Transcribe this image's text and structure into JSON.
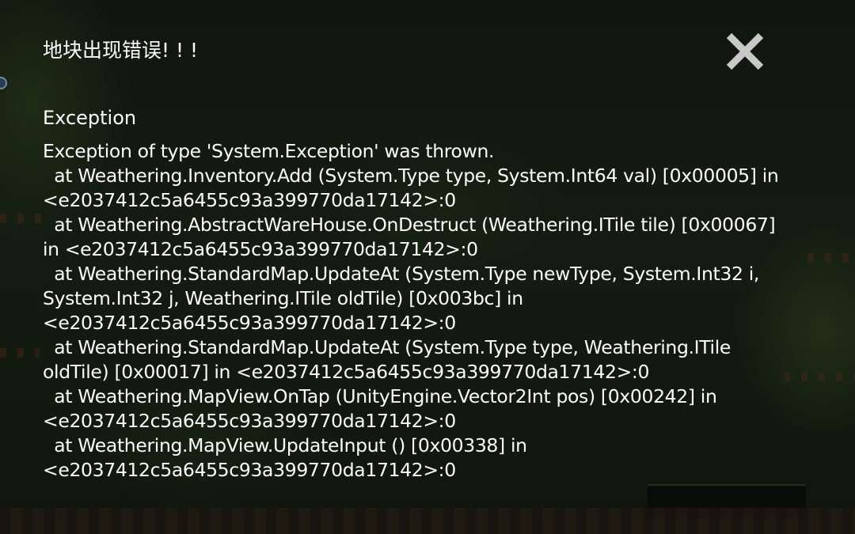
{
  "error_dialog": {
    "title": "地块出现错误! ! !",
    "close_icon": "close-x-icon",
    "exception_header": "Exception",
    "stack_trace_lines": [
      "Exception of type 'System.Exception' was thrown.",
      "  at Weathering.Inventory.Add (System.Type type, System.Int64 val) [0x00005] in",
      "<e2037412c5a6455c93a399770da17142>:0",
      "  at Weathering.AbstractWareHouse.OnDestruct (Weathering.ITile tile) [0x00067]",
      "in <e2037412c5a6455c93a399770da17142>:0",
      "  at Weathering.StandardMap.UpdateAt (System.Type newType, System.Int32 i,",
      "System.Int32 j, Weathering.ITile oldTile) [0x003bc] in",
      "<e2037412c5a6455c93a399770da17142>:0",
      "  at Weathering.StandardMap.UpdateAt (System.Type type, Weathering.ITile",
      "oldTile) [0x00017] in <e2037412c5a6455c93a399770da17142>:0",
      "  at Weathering.MapView.OnTap (UnityEngine.Vector2Int pos) [0x00242] in",
      "<e2037412c5a6455c93a399770da17142>:0",
      "  at Weathering.MapView.UpdateInput () [0x00338] in",
      "<e2037412c5a6455c93a399770da17142>:0"
    ]
  },
  "colors": {
    "text": "#ffffff",
    "close_icon": "#c8c8c8",
    "overlay_background": "#0d110c"
  }
}
